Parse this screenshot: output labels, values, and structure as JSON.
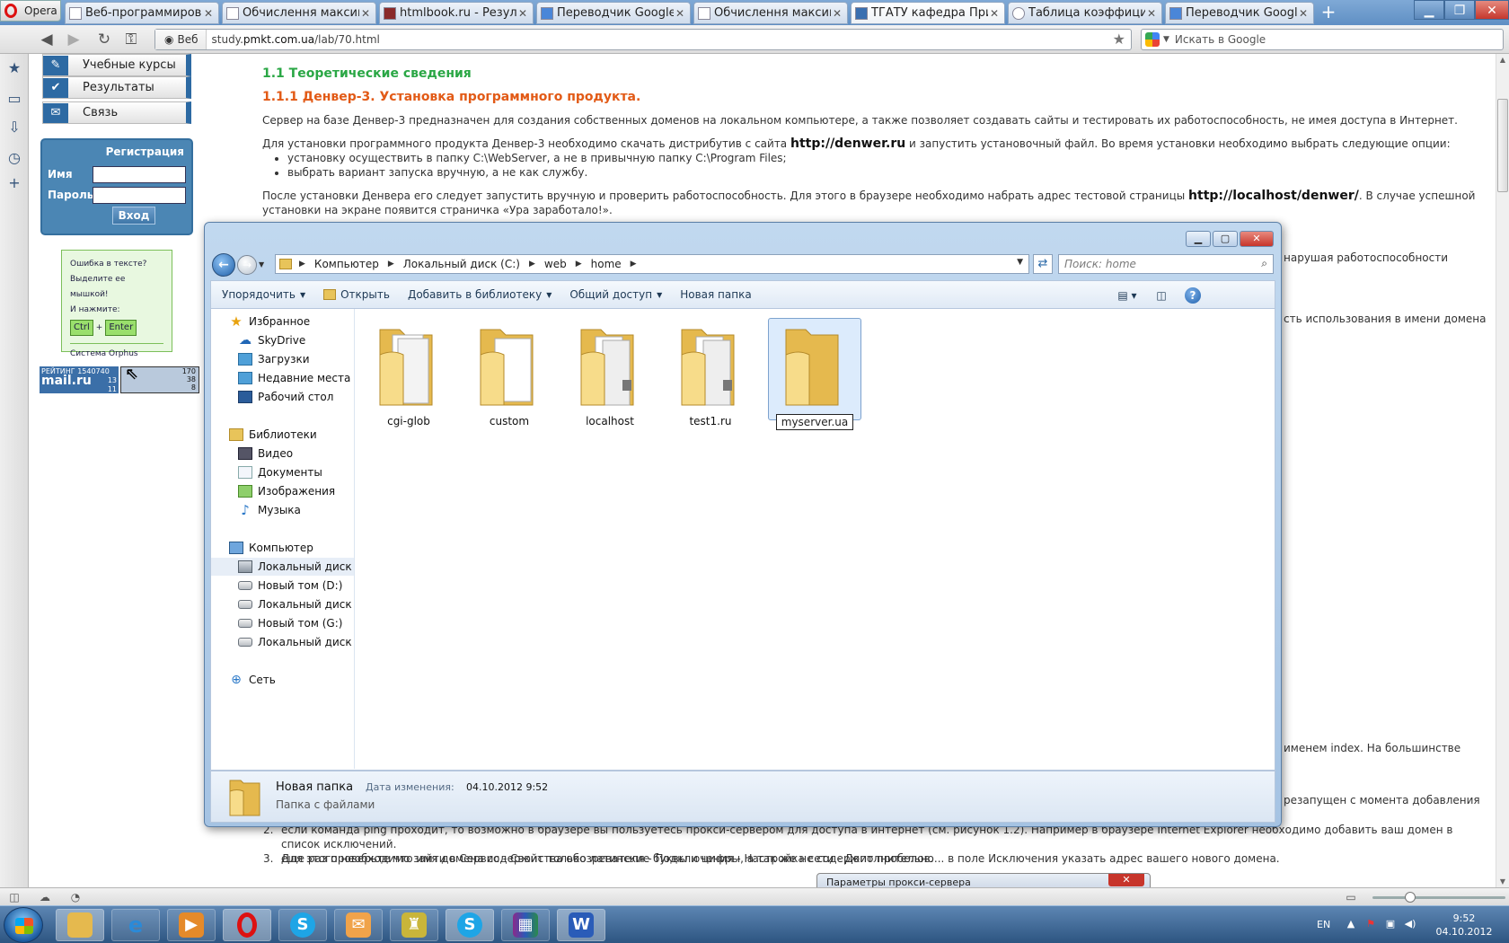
{
  "browser": {
    "menu_label": "Opera",
    "tabs": [
      {
        "label": "Веб-программирован..."
      },
      {
        "label": "Обчислення максима..."
      },
      {
        "label": "htmlbook.ru - Результ..."
      },
      {
        "label": "Переводчик Google"
      },
      {
        "label": "Обчислення максима..."
      },
      {
        "label": "ТГАТУ кафедра Прикл..."
      },
      {
        "label": "Таблица коэффициен..."
      },
      {
        "label": "Переводчик Google"
      }
    ],
    "address": {
      "site_label": "Веб",
      "domain": "study.",
      "domain_bold": "pmkt.com.ua",
      "path": "/lab/70.html"
    },
    "search_placeholder": "Искать в Google"
  },
  "page": {
    "menu": [
      {
        "label": "Учебные курсы"
      },
      {
        "label": "Результаты"
      },
      {
        "label": "Связь"
      }
    ],
    "login": {
      "title": "Регистрация",
      "name_label": "Имя",
      "password_label": "Пароль",
      "submit_label": "Вход"
    },
    "orphus": {
      "line1": "Ошибка в тексте?",
      "line2": "Выделите ее мышкой!",
      "line3": "И нажмите:",
      "key1": "Ctrl",
      "plus": "+",
      "key2": "Enter",
      "system": "Система Orphus"
    },
    "rating_mail": {
      "label": "РЕЙТИНГ",
      "total": "1540740",
      "brand": "mail.ru",
      "n1": "13",
      "n2": "11"
    },
    "rating_2": {
      "n1": "170",
      "n2": "38",
      "n3": "8"
    },
    "content": {
      "h_theory": "1.1 Теоретические сведения",
      "h_denwer": "1.1.1 Денвер-3. Установка программного продукта.",
      "p1": "Сервер на базе Денвер-3 предназначен для создания собственных доменов на локальном компьютере, а также позволяет создавать сайты и тестировать их работоспособность, не имея доступа в Интернет.",
      "p2_a": "Для установки программного продукта Денвер-3 необходимо скачать дистрибутив с сайта ",
      "p2_link": "http://denwer.ru",
      "p2_b": " и запустить установочный файл. Во время установки необходимо выбрать следующие опции:",
      "li1": "установку осуществить в папку C:\\WebServer, а не в привычную папку C:\\Program Files;",
      "li2": "выбрать вариант запуска вручную, а не как службу.",
      "p3_a": "После установки Денвера его следует запустить вручную и проверить работоспособность. Для этого в браузере необходимо набрать адрес тестовой страницы ",
      "p3_link": "http://localhost/denwer/",
      "p3_b": ". В случае успешной установки на экране появится страничка «Ура заработало!».",
      "peek1": "нарушая работоспособности",
      "peek2": "сть использования в имени домена",
      "peek3": "именем index. На большинстве",
      "peek4": "резапущен с момента добавления",
      "li_n2a": "если команда ping проходит, то возможно в браузере вы пользуетесь прокси-сервером для доступа в интернет (см. рисунок 1.2). Например в браузере Internet Explorer необходимо добавить ваш домен в список исключений.",
      "li_n2b": "Для этого необходимо зайти в Сервис - Свойства обозревателя - Подключения - Настройка сети - Дополнительно... в поле Исключения указать адрес вашего нового домена.",
      "li_n3": "еще раз проверьте что имя домена содержит только латинские буквы и цифры, а так же не содержит пробелов.",
      "n2": "2.",
      "n3": "3."
    },
    "proxy_dialog_title": "Параметры прокси-сервера"
  },
  "explorer": {
    "breadcrumb": [
      "Компьютер",
      "Локальный диск (C:)",
      "web",
      "home"
    ],
    "search_placeholder": "Поиск: home",
    "toolbar": {
      "organize": "Упорядочить",
      "open": "Открыть",
      "add_library": "Добавить в библиотеку",
      "share": "Общий доступ",
      "new_folder": "Новая папка"
    },
    "tree": {
      "favorites": "Избранное",
      "skydrive": "SkyDrive",
      "downloads": "Загрузки",
      "recent": "Недавние места",
      "desktop": "Рабочий стол",
      "libraries": "Библиотеки",
      "video": "Видео",
      "documents": "Документы",
      "images": "Изображения",
      "music": "Музыка",
      "computer": "Компьютер",
      "drive_c": "Локальный диск (C",
      "drive_d": "Новый том (D:)",
      "drive_f": "Локальный диск (F:",
      "drive_g": "Новый том (G:)",
      "drive_z": "Локальный диск (Z",
      "network": "Сеть"
    },
    "files": [
      {
        "name": "cgi-glob"
      },
      {
        "name": "custom"
      },
      {
        "name": "localhost"
      },
      {
        "name": "test1.ru"
      },
      {
        "name": "myserver.ua"
      }
    ],
    "details": {
      "name": "Новая папка",
      "type": "Папка с файлами",
      "modified_label": "Дата изменения:",
      "modified_value": "04.10.2012 9:52"
    }
  },
  "taskbar": {
    "lang": "EN",
    "time": "9:52",
    "date": "04.10.2012"
  }
}
